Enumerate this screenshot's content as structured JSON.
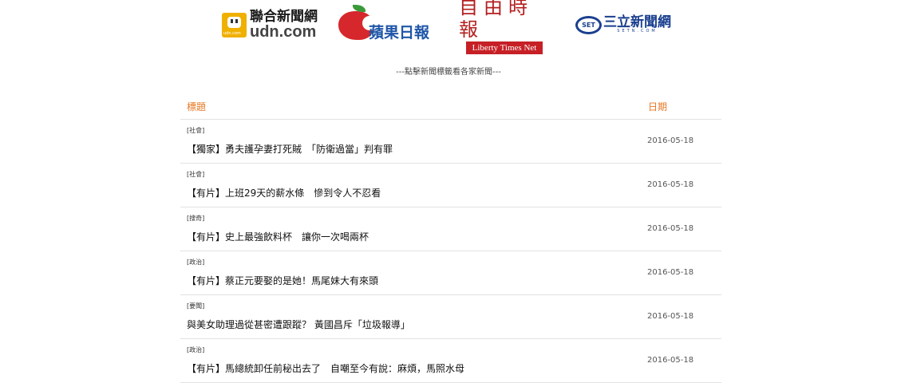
{
  "logos": {
    "udn": {
      "chinese": "聯合新聞網",
      "english": "udn.com",
      "small": "udn.com"
    },
    "apple": {
      "text": "蘋果日報"
    },
    "ltn": {
      "chinese": "自由時報",
      "english": "Liberty Times Net"
    },
    "setn": {
      "mark": "SET",
      "chinese": "三立新聞網",
      "english": "SETN.COM"
    }
  },
  "hint": "---點擊新聞標籤看各家新聞---",
  "table": {
    "header_title": "標題",
    "header_date": "日期",
    "rows": [
      {
        "category": "[社會]",
        "title": "【獨家】勇夫護孕妻打死賊　「防衛過當」判有罪",
        "date": "2016-05-18"
      },
      {
        "category": "[社會]",
        "title": "【有片】上班29天的薪水條　慘到令人不忍看",
        "date": "2016-05-18"
      },
      {
        "category": "[搜奇]",
        "title": "【有片】史上最強飲料杯　讓你一次喝兩杯",
        "date": "2016-05-18"
      },
      {
        "category": "[政治]",
        "title": "【有片】蔡正元要娶的是她！馬尾妹大有來頭",
        "date": "2016-05-18"
      },
      {
        "category": "[要聞]",
        "title": "與美女助理過從甚密遭跟蹤？ 黃國昌斥「垃圾報導」",
        "date": "2016-05-18"
      },
      {
        "category": "[政治]",
        "title": "【有片】馬總統卸任前秘出去了　自嘲至今有說：麻煩，馬照水母",
        "date": "2016-05-18"
      }
    ]
  },
  "colors": {
    "accent": "#e87722",
    "apple_red": "#d6272c",
    "ltn_red": "#c62026",
    "setn_blue": "#1a3f8f",
    "udn_yellow": "#f0b000"
  }
}
